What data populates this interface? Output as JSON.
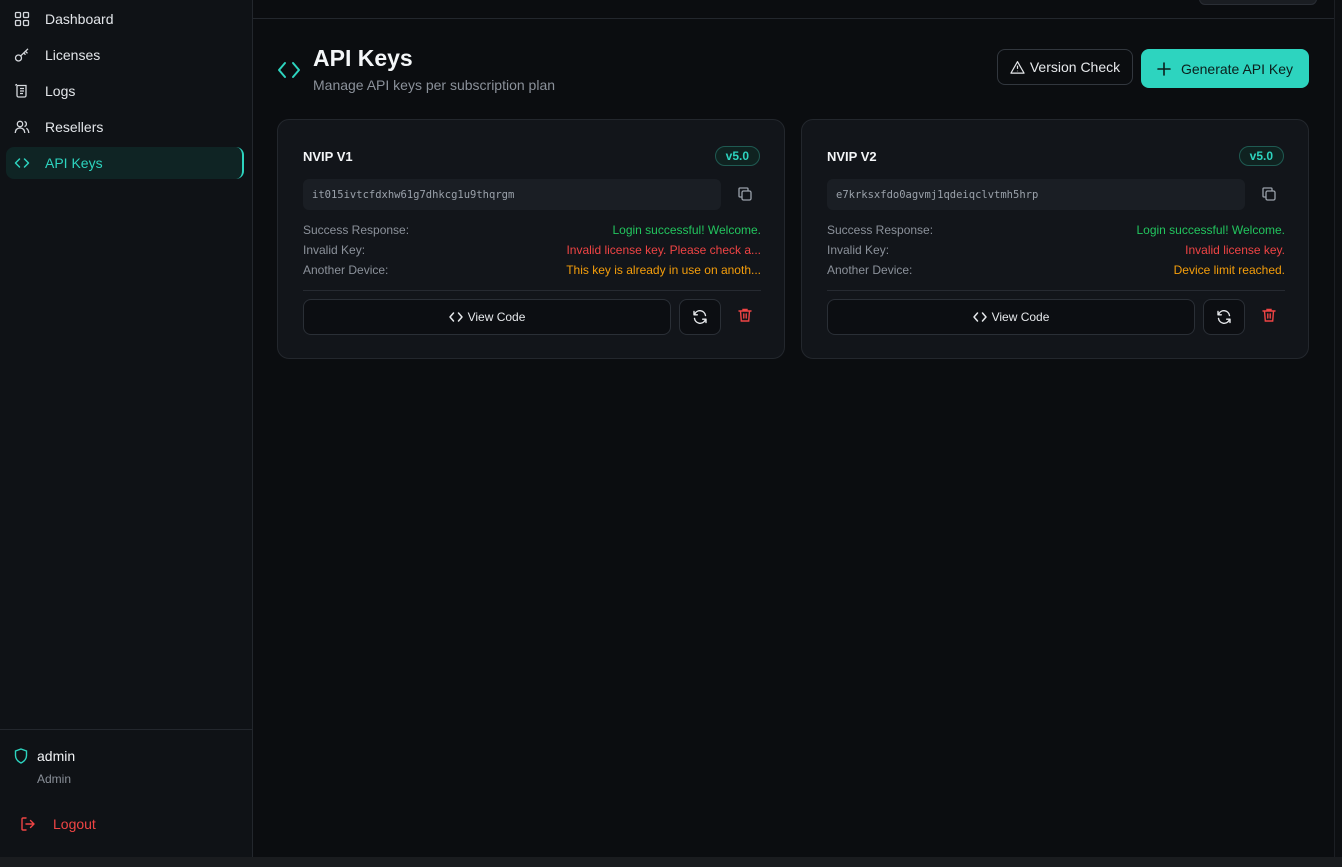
{
  "sidebar": {
    "items": [
      {
        "label": "Dashboard",
        "icon": "grid-icon"
      },
      {
        "label": "Licenses",
        "icon": "key-icon"
      },
      {
        "label": "Logs",
        "icon": "scroll-icon"
      },
      {
        "label": "Resellers",
        "icon": "users-icon"
      },
      {
        "label": "API Keys",
        "icon": "code-icon",
        "active": true
      }
    ],
    "user": {
      "name": "admin",
      "role": "Admin"
    },
    "logout_label": "Logout"
  },
  "header": {
    "title": "API Keys",
    "subtitle": "Manage API keys per subscription plan",
    "version_check_label": "Version Check",
    "generate_label": "Generate API Key"
  },
  "cards": [
    {
      "name": "NVIP V1",
      "version": "v5.0",
      "key": "it015ivtcfdxhw61g7dhkcg1u9thqrgm",
      "responses": [
        {
          "label": "Success Response:",
          "value": "Login successful! Welcome."
        },
        {
          "label": "Invalid Key:",
          "value": "Invalid license key. Please check a..."
        },
        {
          "label": "Another Device:",
          "value": "This key is already in use on anoth..."
        }
      ],
      "view_code_label": "View Code"
    },
    {
      "name": "NVIP V2",
      "version": "v5.0",
      "key": "e7krksxfdo0agvmj1qdeiqclvtmh5hrp",
      "responses": [
        {
          "label": "Success Response:",
          "value": "Login successful! Welcome."
        },
        {
          "label": "Invalid Key:",
          "value": "Invalid license key."
        },
        {
          "label": "Another Device:",
          "value": "Device limit reached."
        }
      ],
      "view_code_label": "View Code"
    }
  ],
  "colors": {
    "accent": "#2dd4bf",
    "success": "#22c55e",
    "danger": "#ef4444",
    "warning": "#f59e0b",
    "background": "#0b0d10"
  }
}
